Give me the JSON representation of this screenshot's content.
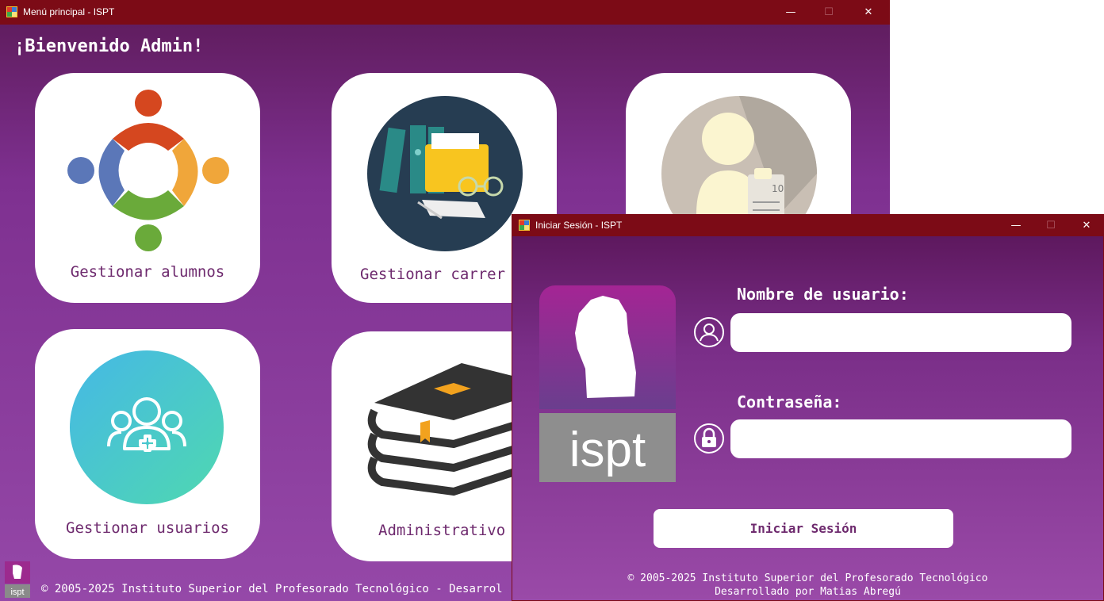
{
  "main_window": {
    "title": "Menú principal - ISPT",
    "welcome": "¡Bienvenido Admin!",
    "cards": {
      "alumnos": "Gestionar alumnos",
      "carreras": "Gestionar carrer",
      "usuarios": "Gestionar usuarios",
      "administrativo": "Administrativo"
    },
    "footer": "© 2005-2025 Instituto Superior del Profesorado Tecnológico - Desarrol"
  },
  "login_window": {
    "title": "Iniciar Sesión - ISPT",
    "username_label": "Nombre de usuario:",
    "username_value": "",
    "password_label": "Contraseña:",
    "password_value": "",
    "login_button": "Iniciar Sesión",
    "footer_line1": "© 2005-2025 Instituto Superior del Profesorado Tecnológico",
    "footer_line2": "Desarrollado por Matias Abregú",
    "logo_text": "ispt"
  },
  "icons": {
    "minimize": "minimize-icon",
    "maximize": "maximize-icon",
    "close": "close-icon",
    "user": "user-circle-icon",
    "lock": "lock-icon"
  },
  "colors": {
    "titlebar": "#7c0b16",
    "card_label": "#6e2a6e",
    "background_top": "#5c1a58",
    "background_bottom": "#9548a8"
  }
}
